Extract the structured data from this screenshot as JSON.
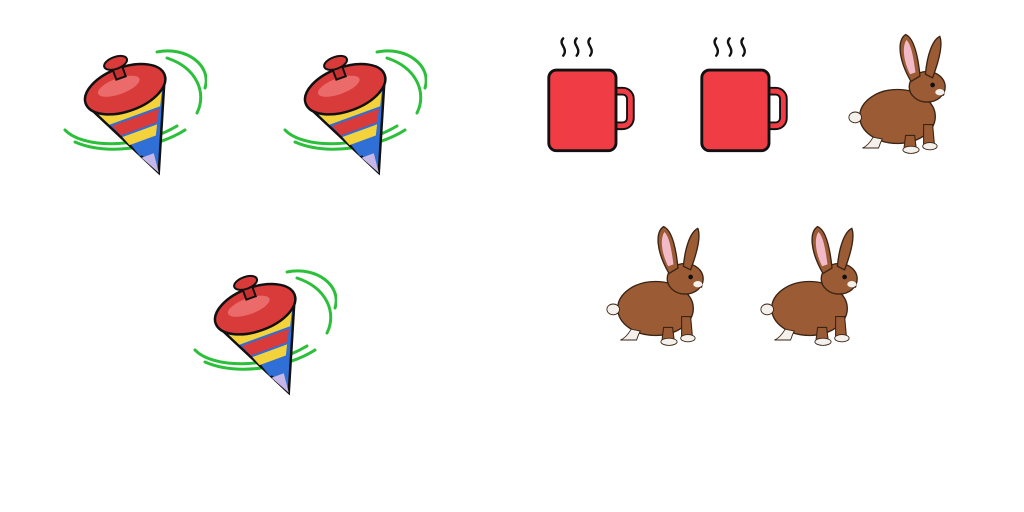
{
  "colors": {
    "background": "#ffffff",
    "top_red": "#d93a3a",
    "top_stripe_yellow": "#f4d23c",
    "top_stripe_blue": "#2f6fd6",
    "top_stripe_purple": "#c6b7e8",
    "motion_green": "#2bbf3a",
    "mug_red": "#f03c44",
    "rabbit_brown": "#9a5b35",
    "rabbit_ear_pink": "#f2b9c7"
  },
  "groups": [
    {
      "name": "spinning-tops",
      "icon": "spinning-top-icon",
      "count": 3
    },
    {
      "name": "mugs",
      "icon": "hot-mug-icon",
      "count": 2
    },
    {
      "name": "rabbits",
      "icon": "rabbit-icon",
      "count": 3
    }
  ]
}
